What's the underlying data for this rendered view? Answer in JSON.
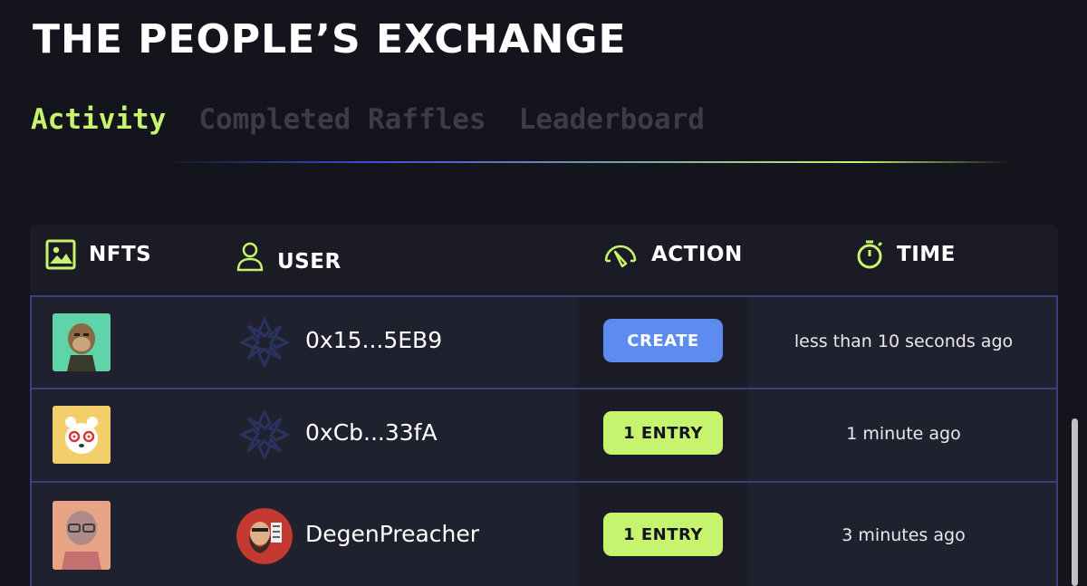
{
  "page_title": "THE PEOPLE’S EXCHANGE",
  "tabs": [
    {
      "label": "Activity",
      "active": true
    },
    {
      "label": "Completed Raffles",
      "active": false
    },
    {
      "label": "Leaderboard",
      "active": false
    }
  ],
  "table": {
    "headers": {
      "nfts": "NFTS",
      "user": "USER",
      "action": "ACTION",
      "time": "TIME"
    },
    "rows": [
      {
        "nft_icon": "ape-nft-thumbnail",
        "user_avatar": "default-asterisk-avatar",
        "user": "0x15...5EB9",
        "action": "CREATE",
        "time": "less than 10 seconds ago"
      },
      {
        "nft_icon": "bear-nft-thumbnail",
        "user_avatar": "default-asterisk-avatar",
        "user": "0xCb...33fA",
        "action": "1 ENTRY",
        "time": "1 minute ago"
      },
      {
        "nft_icon": "pink-character-nft-thumbnail",
        "user_avatar": "bearded-man-avatar",
        "user": "DegenPreacher",
        "action": "1 ENTRY",
        "time": "3 minutes ago"
      }
    ]
  },
  "colors": {
    "accent": "#c6f46e",
    "create_button": "#5e8bf0",
    "background": "#14141c",
    "row_border": "#3c3f7a"
  }
}
